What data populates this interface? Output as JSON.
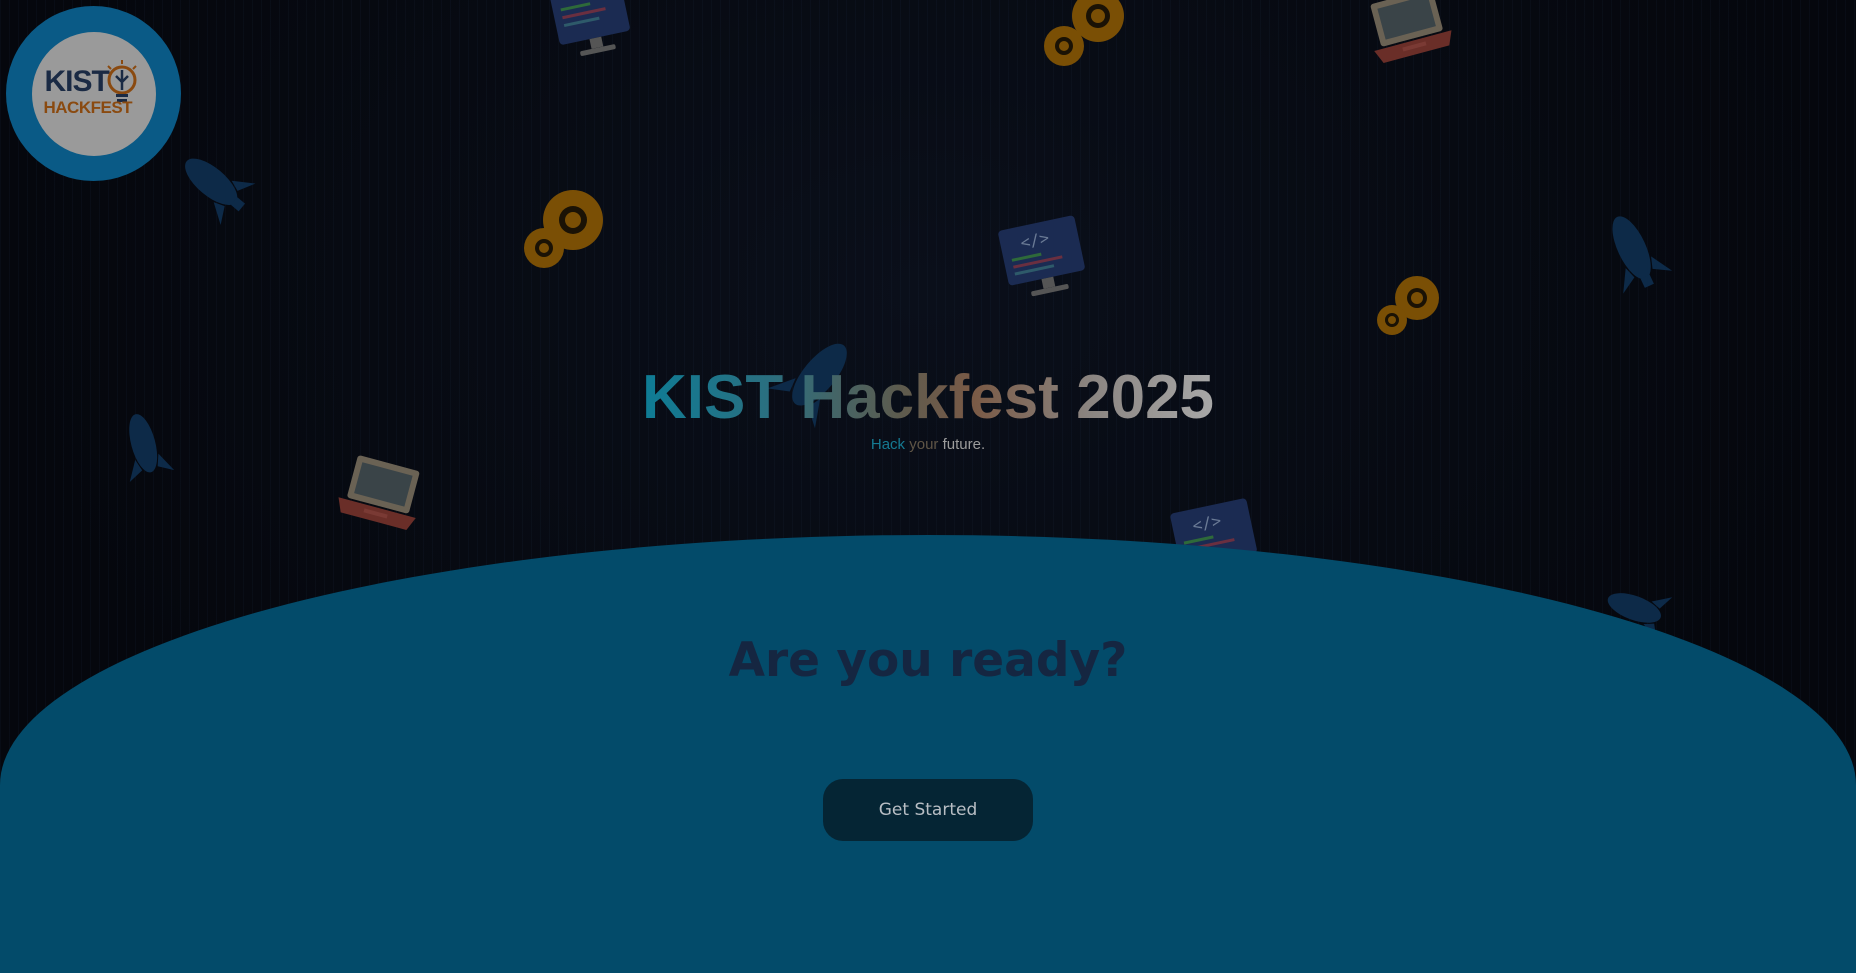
{
  "logo": {
    "line1": "KIST",
    "line2": "HACKFEST"
  },
  "hero": {
    "title": "KIST Hackfest 2025",
    "subtitle": {
      "hack": "Hack",
      "your": "your",
      "future": "future."
    }
  },
  "cta": {
    "heading": "Are you ready?",
    "button_label": "Get Started"
  },
  "icons": [
    "gear-icon",
    "monitor-code-icon",
    "laptop-icon",
    "rocket-icon"
  ],
  "colors": {
    "background": "#05070d",
    "logo_ring": "#0a5a86",
    "dome": "#034b6a",
    "heading": "#152641",
    "button": "#052534",
    "accent_orange": "#8a4a10"
  }
}
